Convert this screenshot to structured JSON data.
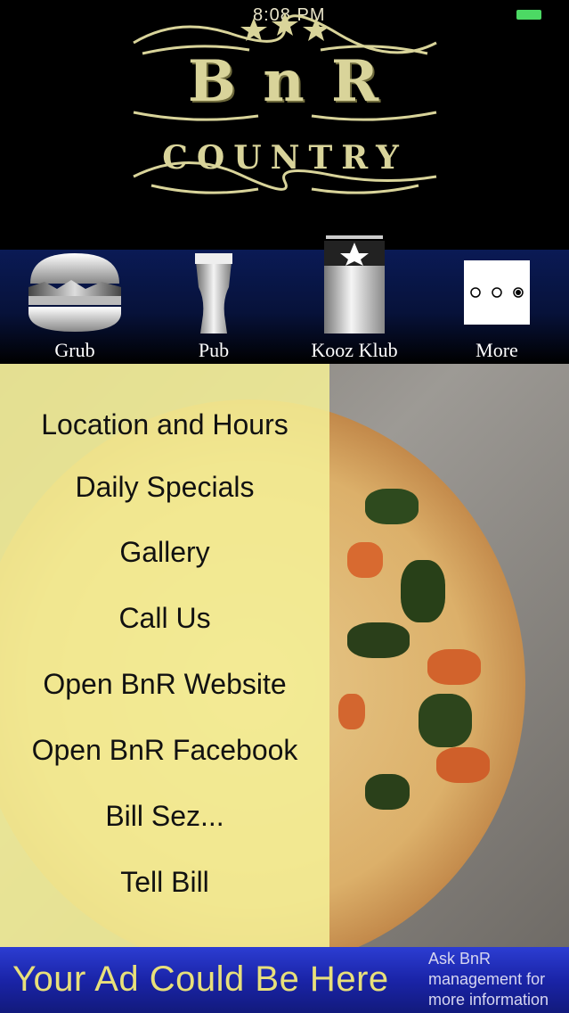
{
  "status_bar": {
    "time": "8:08 PM",
    "battery_color": "#4cd964"
  },
  "logo": {
    "top_text": "B n R",
    "bottom_text": "COUNTRY"
  },
  "tabs": [
    {
      "label": "Grub",
      "icon": "burger-icon"
    },
    {
      "label": "Pub",
      "icon": "beer-glass-icon"
    },
    {
      "label": "Kooz Klub",
      "icon": "koozie-icon"
    },
    {
      "label": "More",
      "icon": "more-dots-icon"
    }
  ],
  "menu": {
    "items": [
      "Location and Hours",
      "Daily Specials",
      "Gallery",
      "Call Us",
      "Open BnR Website",
      "Open BnR Facebook",
      "Bill Sez...",
      "Tell Bill"
    ]
  },
  "ad": {
    "headline": "Your Ad Could Be Here",
    "line1": "Ask BnR",
    "line2": "management for",
    "line3": "more information"
  },
  "colors": {
    "menu_panel": "#f4f096",
    "ad_text": "#e8e07a",
    "ad_bg": "#1a24a8"
  }
}
